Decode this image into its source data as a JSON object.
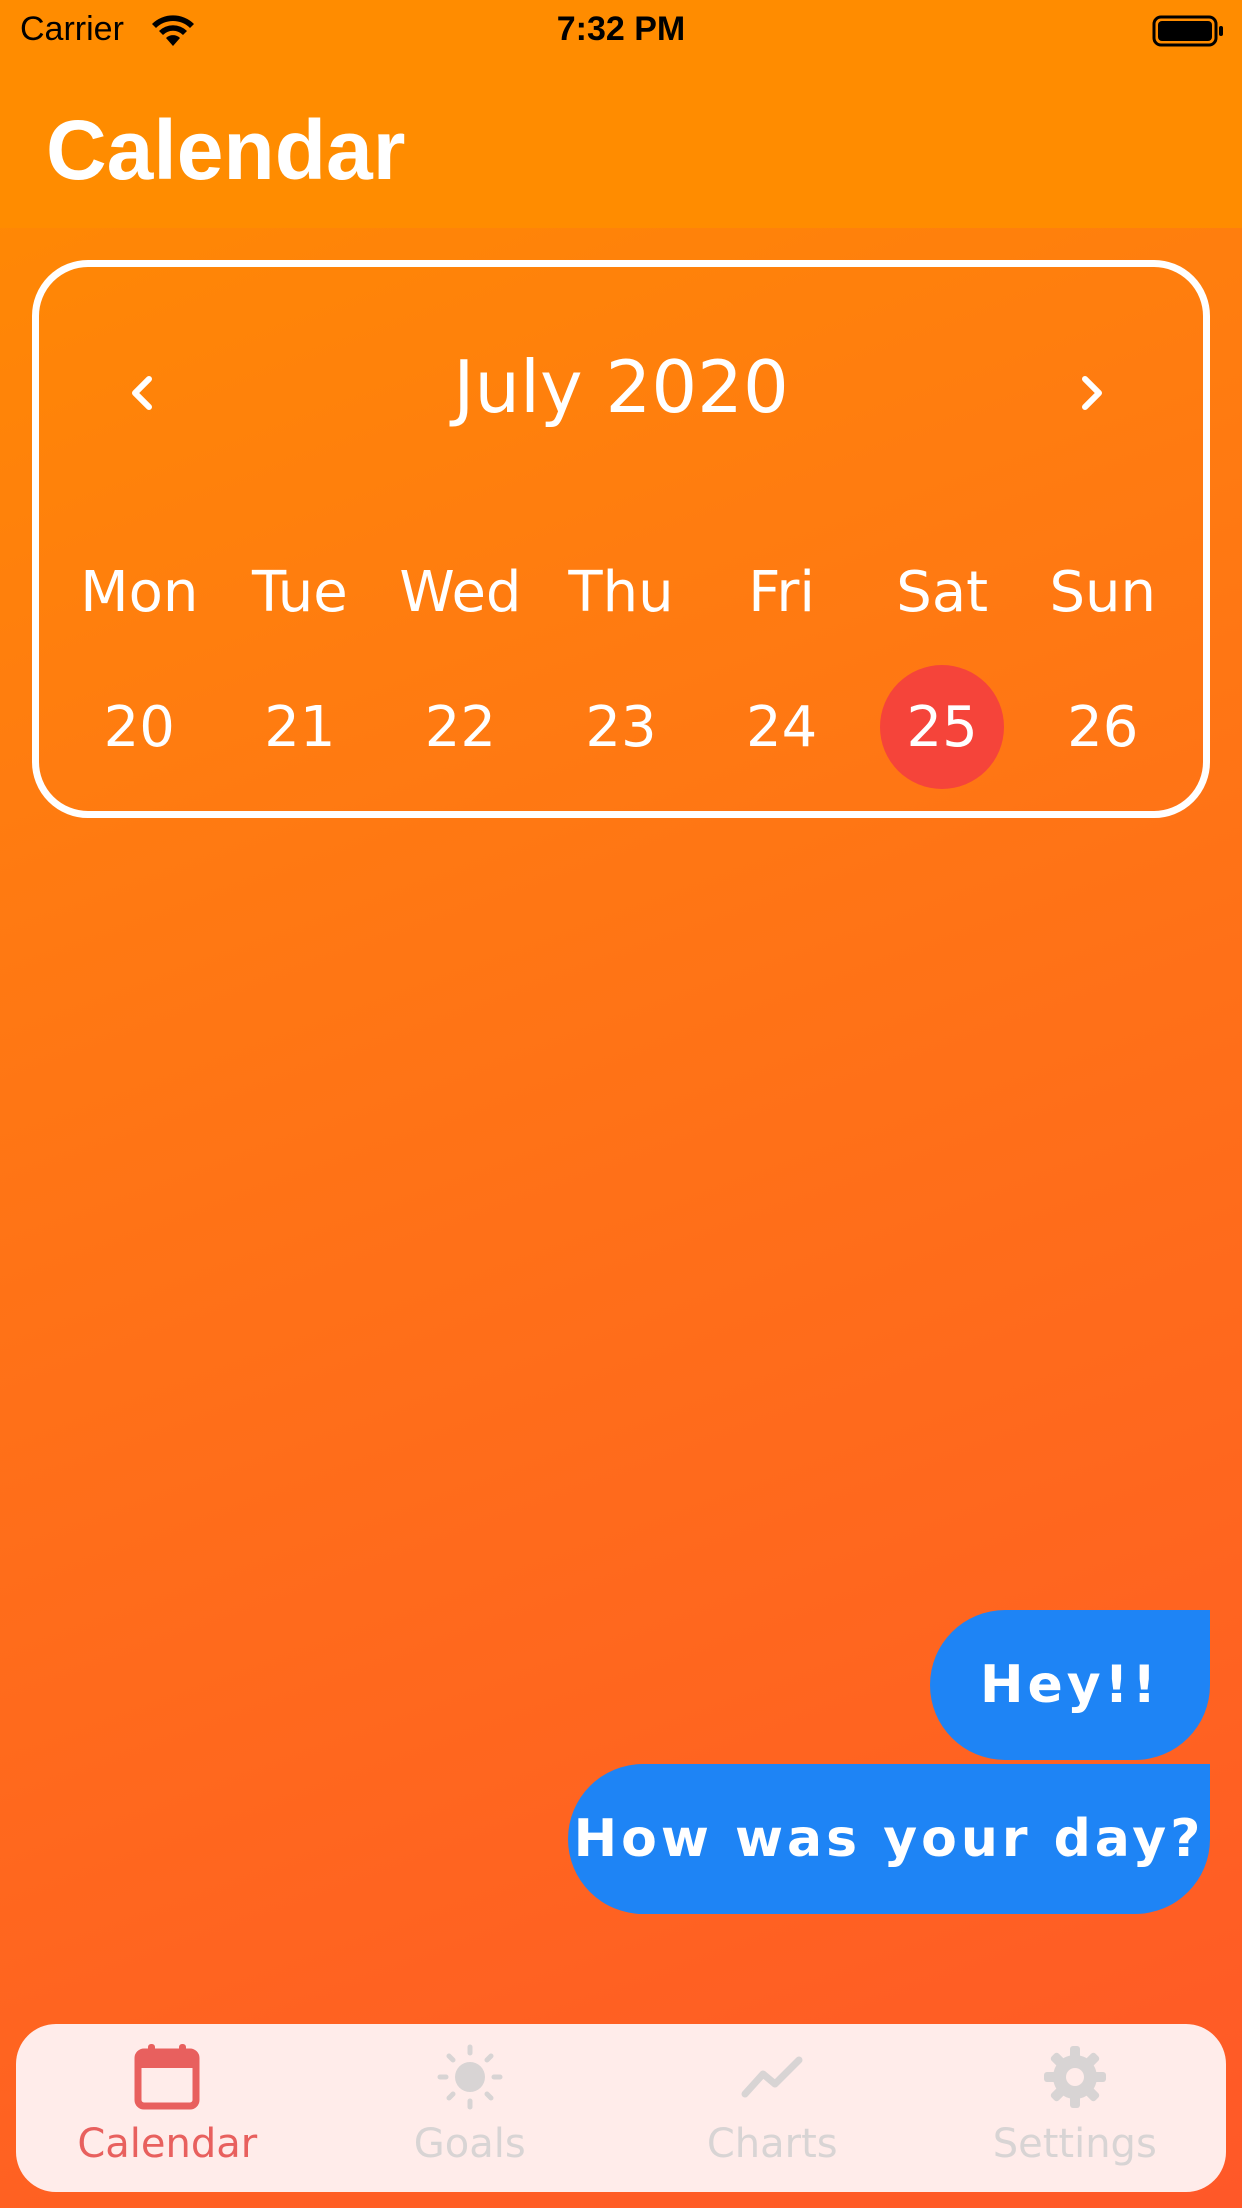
{
  "status_bar": {
    "carrier": "Carrier",
    "time": "7:32 PM"
  },
  "header": {
    "title": "Calendar"
  },
  "calendar": {
    "month_label": "July 2020",
    "weekdays": [
      "Mon",
      "Tue",
      "Wed",
      "Thu",
      "Fri",
      "Sat",
      "Sun"
    ],
    "dates": [
      "20",
      "21",
      "22",
      "23",
      "24",
      "25",
      "26"
    ],
    "selected_date": "25",
    "selected_color": "#f5443a"
  },
  "messages": [
    {
      "text": "Hey!!"
    },
    {
      "text": "How was your day?"
    }
  ],
  "tab_bar": {
    "tabs": [
      {
        "label": "Calendar",
        "icon": "calendar-icon",
        "active": true
      },
      {
        "label": "Goals",
        "icon": "sun-icon",
        "active": false
      },
      {
        "label": "Charts",
        "icon": "chart-line-icon",
        "active": false
      },
      {
        "label": "Settings",
        "icon": "gear-icon",
        "active": false
      }
    ]
  },
  "colors": {
    "accent": "#ff8c00",
    "bubble": "#1e84f5",
    "tab_active": "#e8605e",
    "tab_inactive": "#d8d4d4"
  }
}
